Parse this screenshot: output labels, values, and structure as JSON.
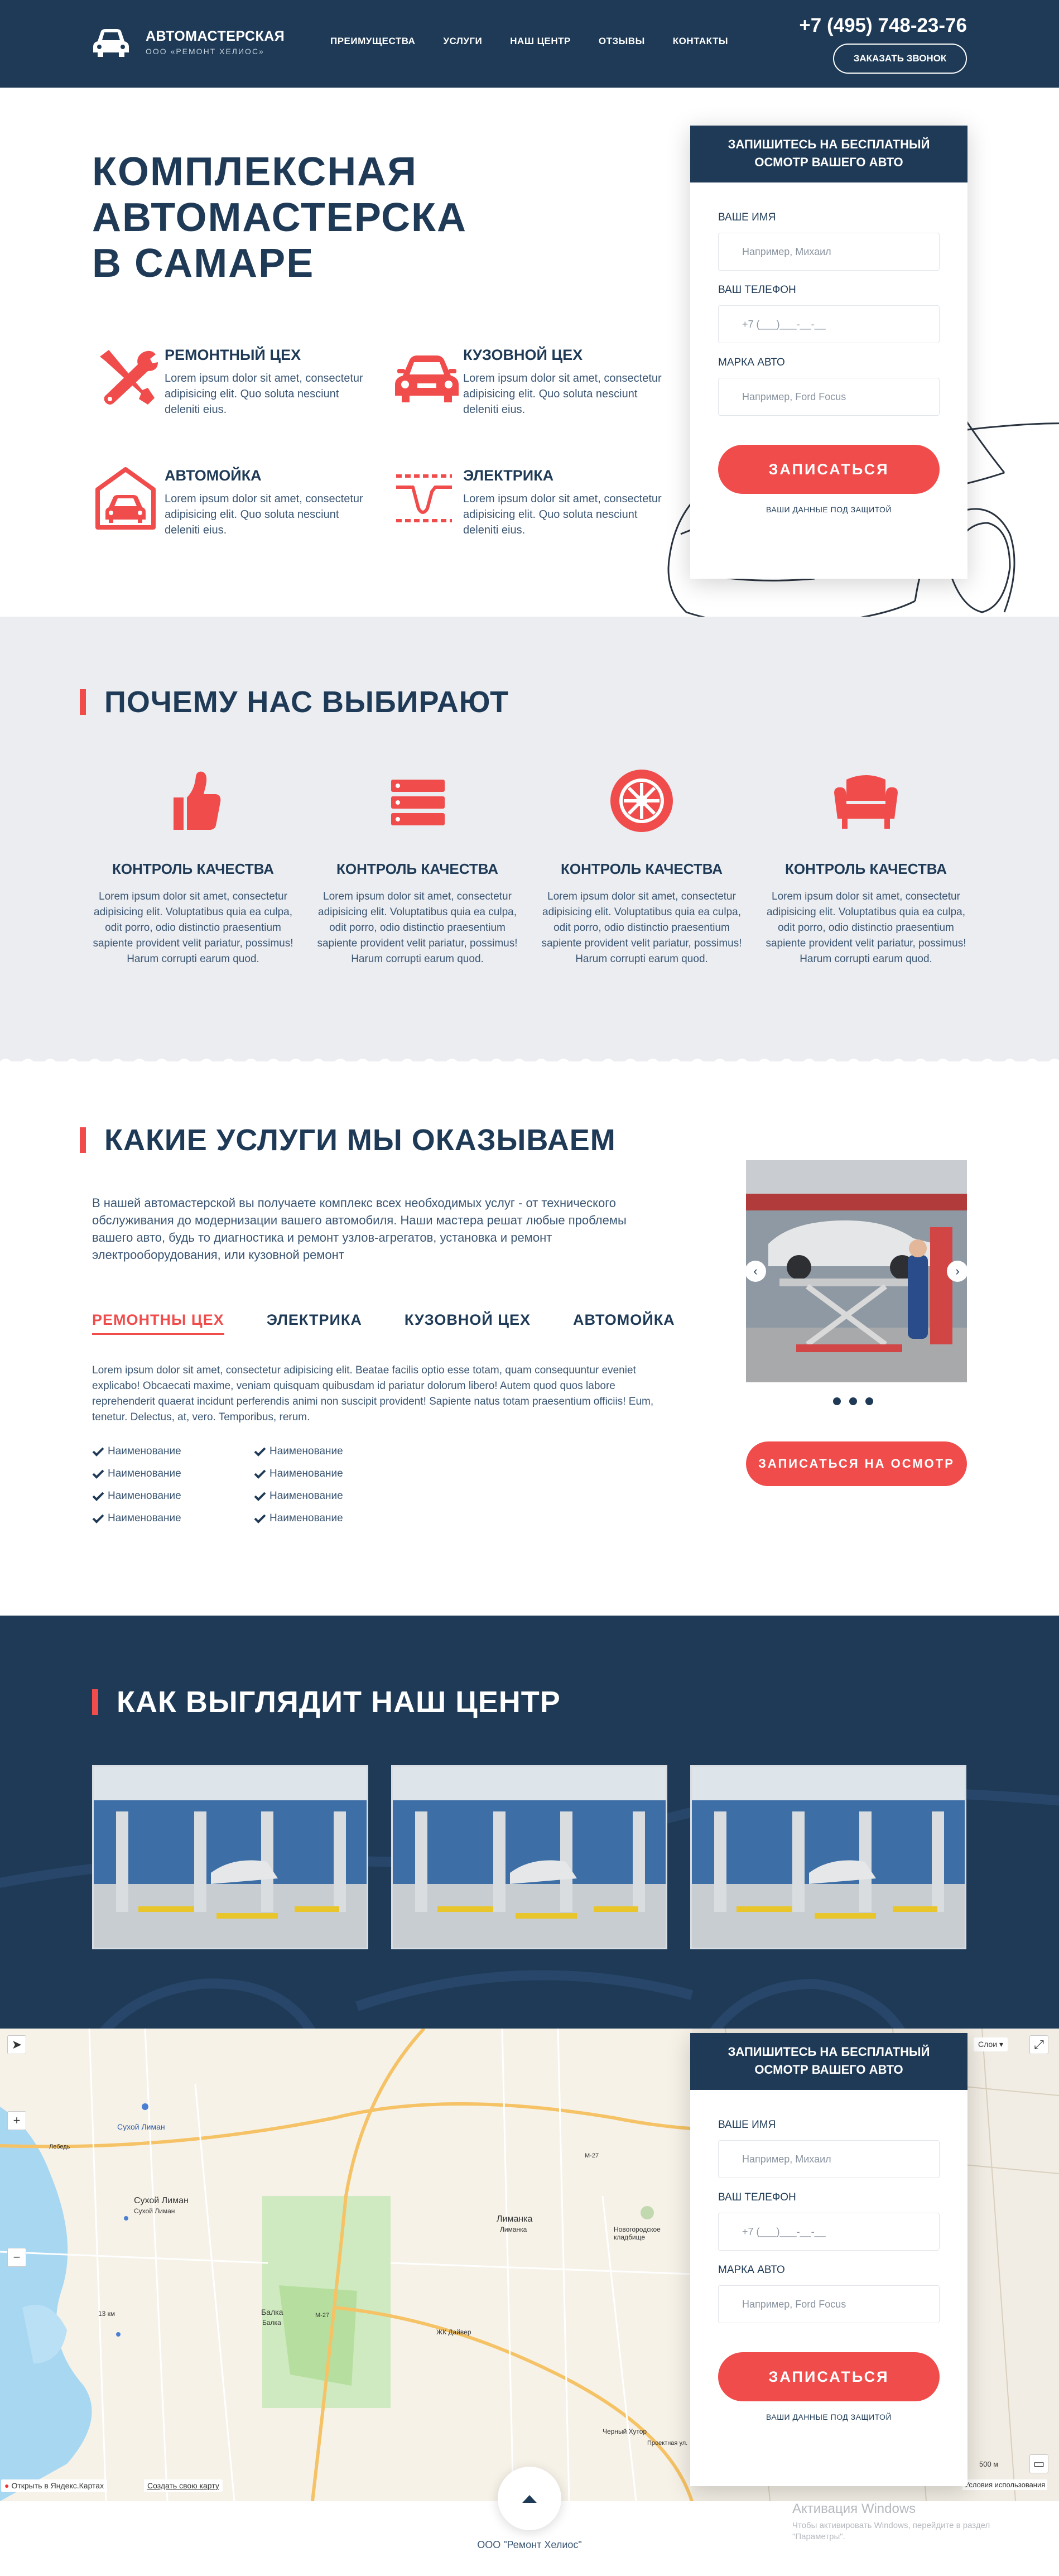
{
  "header": {
    "logo_title": "АВТОМАСТЕРСКАЯ",
    "logo_sub": "ООО «РЕМОНТ ХЕЛИОС»",
    "nav": [
      "ПРЕИМУЩЕСТВА",
      "УСЛУГИ",
      "НАШ ЦЕНТР",
      "ОТЗЫВЫ",
      "КОНТАКТЫ"
    ],
    "phone": "+7 (495) 748-23-76",
    "callback": "ЗАКАЗАТЬ ЗВОНОК"
  },
  "hero": {
    "title_l1": "КОМПЛЕКСНАЯ",
    "title_l2": "АВТОМАСТЕРСКА",
    "title_l3": "В САМАРЕ",
    "services": [
      {
        "title": "РЕМОНТНЫЙ ЦЕХ",
        "text": "Lorem ipsum dolor sit amet, consectetur adipisicing elit. Quo soluta nesciunt deleniti eius.",
        "icon": "wrench-screwdriver-icon"
      },
      {
        "title": "КУЗОВНОЙ ЦЕХ",
        "text": "Lorem ipsum dolor sit amet, consectetur adipisicing elit. Quo soluta nesciunt deleniti eius.",
        "icon": "car-icon"
      },
      {
        "title": "АВТОМОЙКА",
        "text": "Lorem ipsum dolor sit amet, consectetur adipisicing elit. Quo soluta nesciunt deleniti eius.",
        "icon": "garage-icon"
      },
      {
        "title": "ЭЛЕКТРИКА",
        "text": "Lorem ipsum dolor sit amet, consectetur adipisicing elit. Quo soluta nesciunt deleniti eius.",
        "icon": "electric-signal-icon"
      }
    ]
  },
  "form": {
    "title_l1": "ЗАПИШИТЕСЬ НА БЕСПЛАТНЫЙ",
    "title_l2": "ОСМОТР ВАШЕГО АВТО",
    "name_label": "ВАШЕ ИМЯ",
    "name_placeholder": "Например, Михаил",
    "phone_label": "ВАШ ТЕЛЕФОН",
    "phone_placeholder": "+7 (___)___-__-__",
    "car_label": "МАРКА АВТО",
    "car_placeholder": "Например, Ford Focus",
    "submit": "ЗАПИСАТЬСЯ",
    "note": "ВАШИ ДАННЫЕ ПОД ЗАЩИТОЙ"
  },
  "why": {
    "title": "ПОЧЕМУ НАС ВЫБИРАЮТ",
    "items": [
      {
        "title": "КОНТРОЛЬ КАЧЕСТВА",
        "text": "Lorem ipsum dolor sit amet, consectetur adipisicing elit. Voluptatibus quia ea culpa, odit porro, odio distinctio praesentium sapiente provident velit pariatur, possimus! Harum corrupti earum quod.",
        "icon": "thumbs-up-icon"
      },
      {
        "title": "КОНТРОЛЬ КАЧЕСТВА",
        "text": "Lorem ipsum dolor sit amet, consectetur adipisicing elit. Voluptatibus quia ea culpa, odit porro, odio distinctio praesentium sapiente provident velit pariatur, possimus! Harum corrupti earum quod.",
        "icon": "list-icon"
      },
      {
        "title": "КОНТРОЛЬ КАЧЕСТВА",
        "text": "Lorem ipsum dolor sit amet, consectetur adipisicing elit. Voluptatibus quia ea culpa, odit porro, odio distinctio praesentium sapiente provident velit pariatur, possimus! Harum corrupti earum quod.",
        "icon": "wheel-icon"
      },
      {
        "title": "КОНТРОЛЬ КАЧЕСТВА",
        "text": "Lorem ipsum dolor sit amet, consectetur adipisicing elit. Voluptatibus quia ea culpa, odit porro, odio distinctio praesentium sapiente provident velit pariatur, possimus! Harum corrupti earum quod.",
        "icon": "armchair-icon"
      }
    ]
  },
  "services": {
    "title": "КАКИЕ УСЛУГИ МЫ ОКАЗЫВАЕМ",
    "description": "В нашей автомастерской вы получаете комплекс всех необходимых услуг - от технического обслуживания до модернизации вашего автомобиля. Наши мастера решат любые проблемы вашего авто, будь то диагностика и ремонт узлов-агрегатов, установка и ремонт электрооборудования, или кузовной ремонт",
    "tabs": [
      "РЕМОНТНЫ ЦЕХ",
      "ЭЛЕКТРИКА",
      "КУЗОВНОЙ ЦЕХ",
      "АВТОМОЙКА"
    ],
    "tab_text": "Lorem ipsum dolor sit amet, consectetur adipisicing elit. Beatae facilis optio esse totam, quam consequuntur eveniet explicabo! Obcaecati maxime, veniam quisquam quibusdam id pariatur dolorum libero! Autem quod quos labore reprehenderit quaerat incidunt perferendis animi non suscipit provident! Sapiente natus totam praesentium officiis! Eum, tenetur. Delectus, at, vero. Temporibus, rerum.",
    "checklist": [
      "Наименование",
      "Наименование",
      "Наименование",
      "Наименование",
      "Наименование",
      "Наименование",
      "Наименование",
      "Наименование"
    ],
    "cta": "ЗАПИСАТЬСЯ НА ОСМОТР"
  },
  "center": {
    "title": "КАК ВЫГЛЯДИТ НАШ ЦЕНТР"
  },
  "map": {
    "labels": [
      "Сухой Лиман",
      "Сухой Лиман",
      "Сухой Лиман",
      "Лиманка",
      "Лиманка",
      "Новогородское кладбище",
      "Балка",
      "Балка",
      "13 км",
      "М-27",
      "М-27",
      "ЖК Дайвер",
      "Черный Хутор",
      "Проектная ул.",
      "Лебедь"
    ],
    "open_in_yandex": "Открыть в Яндекс.Картах",
    "create_map": "Создать свою карту",
    "layers": "Слои",
    "scale": "500 м",
    "terms": "Условия использования"
  },
  "footer": {
    "company": "ООО \"Ремонт Хелиос\""
  },
  "windows_activation": {
    "title": "Активация Windows",
    "text": "Чтобы активировать Windows, перейдите в раздел \"Параметры\"."
  },
  "colors": {
    "navy": "#1e3a56",
    "accent": "#f04c4c",
    "light_bg": "#ebedf1"
  }
}
